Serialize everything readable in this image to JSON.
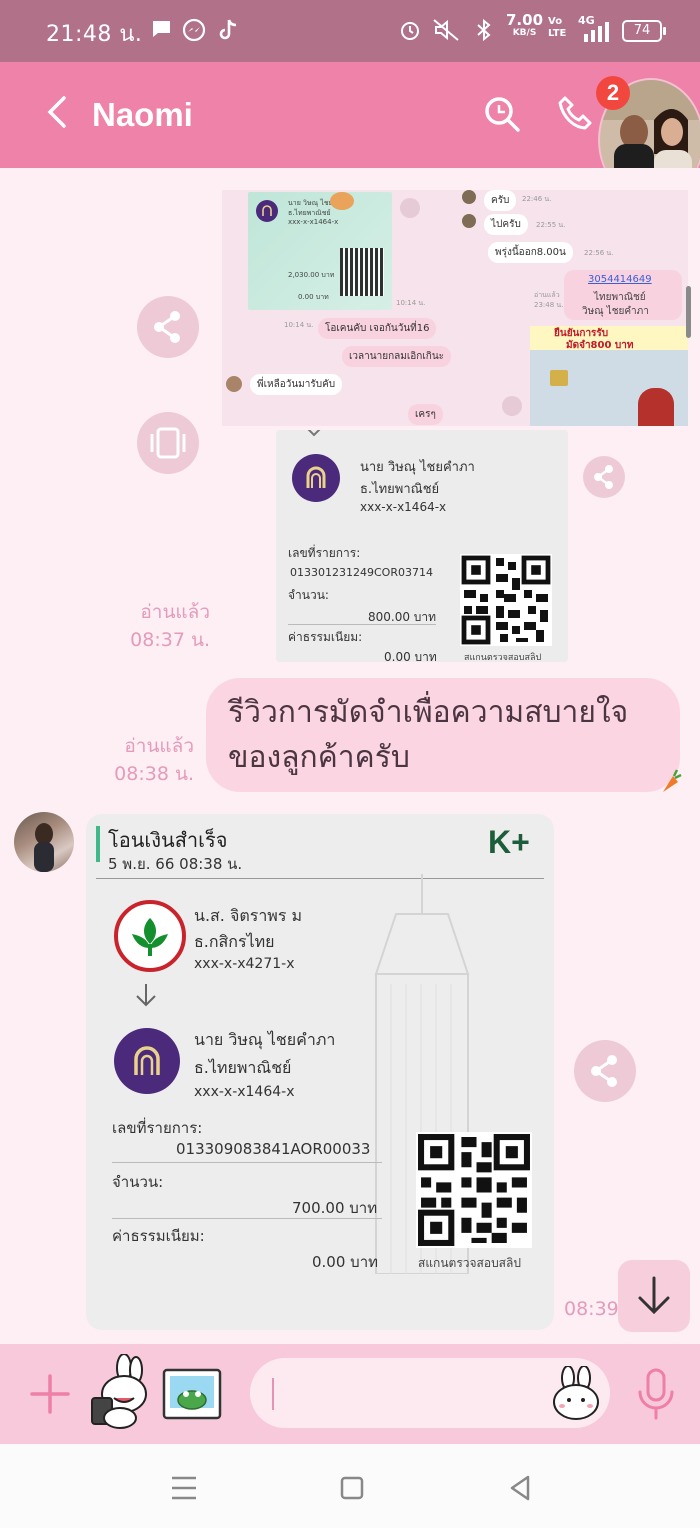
{
  "status_bar": {
    "time": "21:48 น.",
    "net_speed_value": "7.00",
    "net_speed_unit": "KB/S",
    "volte_top": "Vo",
    "volte_bottom": "LTE",
    "network": "4G",
    "battery": "74",
    "icons": [
      "message-icon",
      "messenger-icon",
      "tiktok-icon",
      "alarm-icon",
      "mute-icon",
      "bluetooth-icon",
      "signal-icon",
      "battery-icon"
    ]
  },
  "header": {
    "title": "Naomi",
    "notification_count": "2",
    "background": "#ef82a8"
  },
  "chat": {
    "shared_screenshot": {
      "slip_name": "นาย วิษณุ ไชยคำภา",
      "slip_bank": "ธ.ไทยพาณิชย์",
      "slip_acct": "xxx-x-x1464-x",
      "slip_amount": "2,030.00 บาท",
      "slip_fee": "0.00 บาท",
      "slip_time": "10:14 น.",
      "bubbles_left": [
        "ครับ",
        "ไปครับ",
        "พรุ่งนี้ออก8.00น"
      ],
      "bubbles_right": [
        "โอเคนคับ เจอกันวันที่16",
        "เวลานายกลมเอิกเกินะ",
        "เครๆ"
      ],
      "bubble_other": "พี่เหลือวันมารับคับ",
      "read_label": "อ่านแล้ว",
      "time_a": "22:46 น.",
      "time_b": "10:14 น.",
      "time_c": "22:55 น.",
      "time_d": "22:56 น.",
      "time_e": "23:48 น.",
      "phone": "3054414649",
      "phone_line2": "ไทยพาณิชย์",
      "phone_line3": "วิษณุ ไชยคำภา",
      "id_card_title": "ยืนยันการรับ",
      "id_card_subtitle": "มัดจำ800 บาท"
    },
    "slip1": {
      "name": "นาย วิษณุ ไชยคำภา",
      "bank": "ธ.ไทยพาณิชย์",
      "account": "xxx-x-x1464-x",
      "ref_label": "เลขที่รายการ:",
      "ref": "013301231249COR03714",
      "amount_label": "จำนวน:",
      "amount": "800.00 บาท",
      "fee_label": "ค่าธรรมเนียม:",
      "fee": "0.00 บาท",
      "qr_caption": "สแกนตรวจสอบสลิป"
    },
    "read1": {
      "label": "อ่านแล้ว",
      "time": "08:37 น."
    },
    "message": {
      "text": "รีวิวการมัดจำเพื่อความสบายใจของลูกค้าครับ"
    },
    "read2": {
      "label": "อ่านแล้ว",
      "time": "08:38 น."
    },
    "slip2": {
      "title": "โอนเงินสำเร็จ",
      "datetime": "5 พ.ย. 66  08:38 น.",
      "brand": "K+",
      "from_name": "น.ส. จิตราพร ม",
      "from_bank": "ธ.กสิกรไทย",
      "from_account": "xxx-x-x4271-x",
      "to_name": "นาย วิษณุ ไชยคำภา",
      "to_bank": "ธ.ไทยพาณิชย์",
      "to_account": "xxx-x-x1464-x",
      "ref_label": "เลขที่รายการ:",
      "ref": "013309083841AOR00033",
      "amount_label": "จำนวน:",
      "amount": "700.00 บาท",
      "fee_label": "ค่าธรรมเนียม:",
      "fee": "0.00 บาท",
      "qr_caption": "สแกนตรวจสอบสลิป"
    },
    "slip2_time": "08:39"
  },
  "colors": {
    "accent": "#ef82a8",
    "bubble": "#fbd6e2",
    "read_text": "#e59bba",
    "kbank_green": "#138f2d",
    "scb_purple": "#4b2a7c"
  }
}
